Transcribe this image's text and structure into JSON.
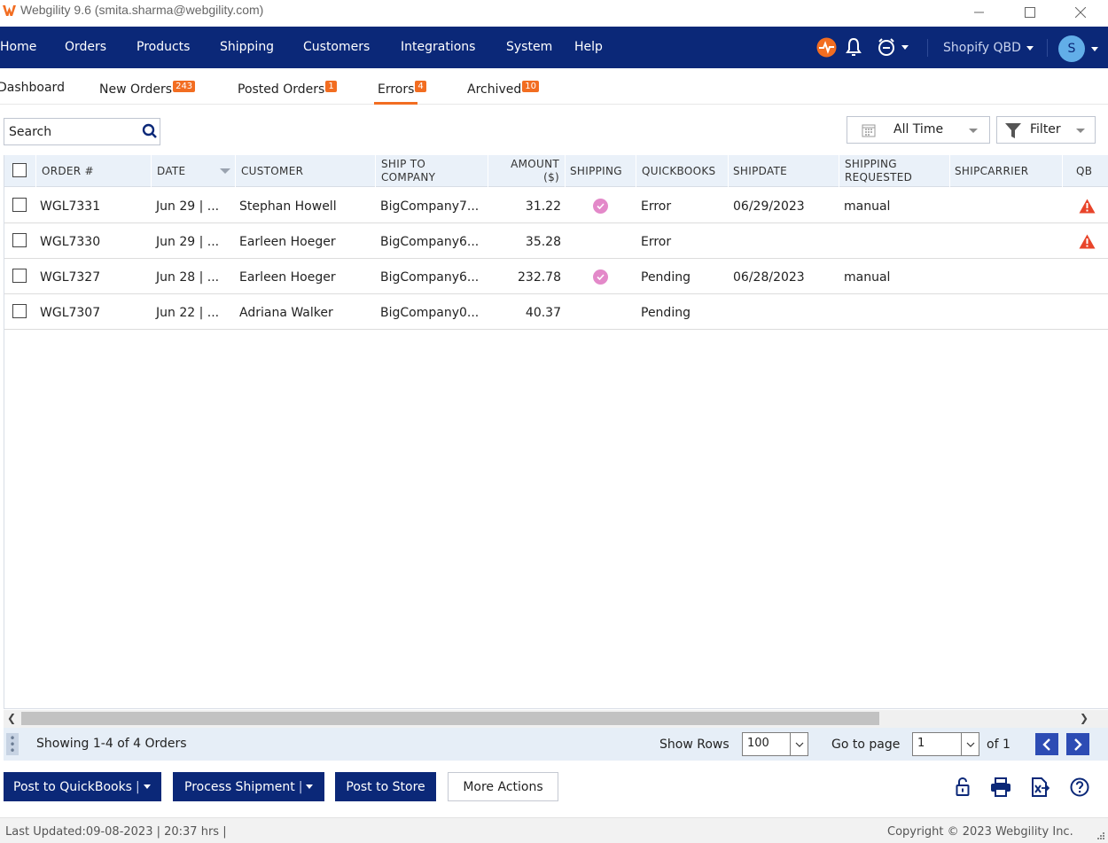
{
  "window": {
    "title": "Webgility 9.6 (smita.sharma@webgility.com)",
    "controls": [
      "minimize-icon",
      "maximize-icon",
      "close-icon"
    ]
  },
  "nav": {
    "items": [
      "Home",
      "Orders",
      "Products",
      "Shipping",
      "Customers",
      "Integrations",
      "System",
      "Help"
    ],
    "store_selector": "Shopify QBD",
    "avatar_initial": "S",
    "icons": [
      "activity-icon",
      "bell-icon",
      "alarm-clock-icon"
    ],
    "activity_color": "#f26d21"
  },
  "tabs": [
    {
      "label": "Dashboard",
      "badge": ""
    },
    {
      "label": "New Orders",
      "badge": "243"
    },
    {
      "label": "Posted Orders",
      "badge": "1"
    },
    {
      "label": "Errors",
      "badge": "4"
    },
    {
      "label": "Archived",
      "badge": "10"
    }
  ],
  "active_tab": "Errors",
  "toolbar": {
    "search_placeholder": "Search",
    "date_range": "All Time",
    "filter_label": "Filter"
  },
  "table": {
    "columns": {
      "order": "ORDER #",
      "date": "DATE",
      "customer": "CUSTOMER",
      "ship_to_1": "SHIP TO",
      "ship_to_2": "COMPANY",
      "amount_1": "AMOUNT",
      "amount_2": "($)",
      "shipping": "SHIPPING",
      "quickbooks": "QUICKBOOKS",
      "shipdate": "SHIPDATE",
      "ship_req_1": "SHIPPING",
      "ship_req_2": "REQUESTED",
      "shipcarrier": "SHIPCARRIER",
      "qb": "QB"
    },
    "rows": [
      {
        "order": "WGL7331",
        "date": "Jun 29 | ...",
        "customer": "Stephan Howell",
        "company": "BigCompany7...",
        "amount": "31.22",
        "shipping": true,
        "quickbooks": "Error",
        "shipdate": "06/29/2023",
        "shipping_requested": "manual",
        "shipcarrier": "",
        "qb_warning": true
      },
      {
        "order": "WGL7330",
        "date": "Jun 29 | ...",
        "customer": "Earleen Hoeger",
        "company": "BigCompany6...",
        "amount": "35.28",
        "shipping": false,
        "quickbooks": "Error",
        "shipdate": "",
        "shipping_requested": "",
        "shipcarrier": "",
        "qb_warning": true
      },
      {
        "order": "WGL7327",
        "date": "Jun 28 | ...",
        "customer": "Earleen Hoeger",
        "company": "BigCompany6...",
        "amount": "232.78",
        "shipping": true,
        "quickbooks": "Pending",
        "shipdate": "06/28/2023",
        "shipping_requested": "manual",
        "shipcarrier": "",
        "qb_warning": false
      },
      {
        "order": "WGL7307",
        "date": "Jun 22 | ...",
        "customer": "Adriana Walker",
        "company": "BigCompany0...",
        "amount": "40.37",
        "shipping": false,
        "quickbooks": "Pending",
        "shipdate": "",
        "shipping_requested": "",
        "shipcarrier": "",
        "qb_warning": false
      }
    ]
  },
  "pager": {
    "showing": "Showing 1-4 of 4 Orders",
    "show_rows_label": "Show Rows",
    "rows_value": "100",
    "goto_label": "Go to page",
    "page_value": "1",
    "of_label": "of 1"
  },
  "actions": {
    "post_quickbooks": "Post to QuickBooks",
    "process_shipment": "Process Shipment",
    "post_store": "Post to Store",
    "more_actions": "More Actions"
  },
  "footer_icons": [
    "unlock-icon",
    "print-icon",
    "export-excel-icon",
    "help-icon"
  ],
  "status": {
    "last_updated": "Last Updated:09-08-2023 | 20:37 hrs |",
    "copyright": "Copyright © 2023 Webgility Inc."
  },
  "colors": {
    "navy": "#0b2878",
    "accent": "#f26d21",
    "shipping_dot": "#e389c9",
    "warning": "#e8442a"
  }
}
